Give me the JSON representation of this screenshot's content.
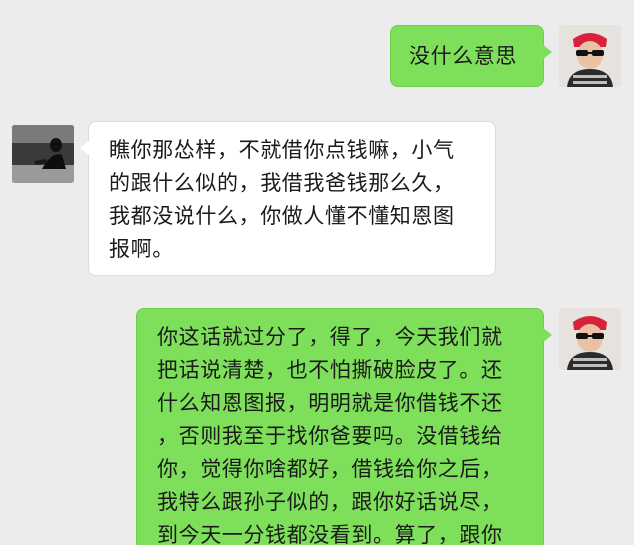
{
  "conversation": {
    "messages": [
      {
        "sender": "me",
        "lines": [
          "没什么意思"
        ]
      },
      {
        "sender": "other",
        "lines": [
          "瞧你那怂样，不就借你点钱嘛，小气",
          "的跟什么似的，我借我爸钱那么久，",
          "我都没说什么，你做人懂不懂知恩图",
          "报啊。"
        ]
      },
      {
        "sender": "me",
        "lines": [
          "你这话就过分了，得了，今天我们就",
          "把话说清楚，也不怕撕破脸皮了。还",
          "什么知恩图报，明明就是你借钱不还",
          "，否则我至于找你爸要吗。没借钱给",
          "你，觉得你啥都好，借钱给你之后，",
          "我特么跟孙子似的，跟你好话说尽，",
          "到今天一分钱都没看到。算了，跟你"
        ]
      }
    ]
  },
  "theme": {
    "background": "#ececec",
    "outgoing_bubble": "#7ee05a",
    "incoming_bubble": "#ffffff"
  }
}
